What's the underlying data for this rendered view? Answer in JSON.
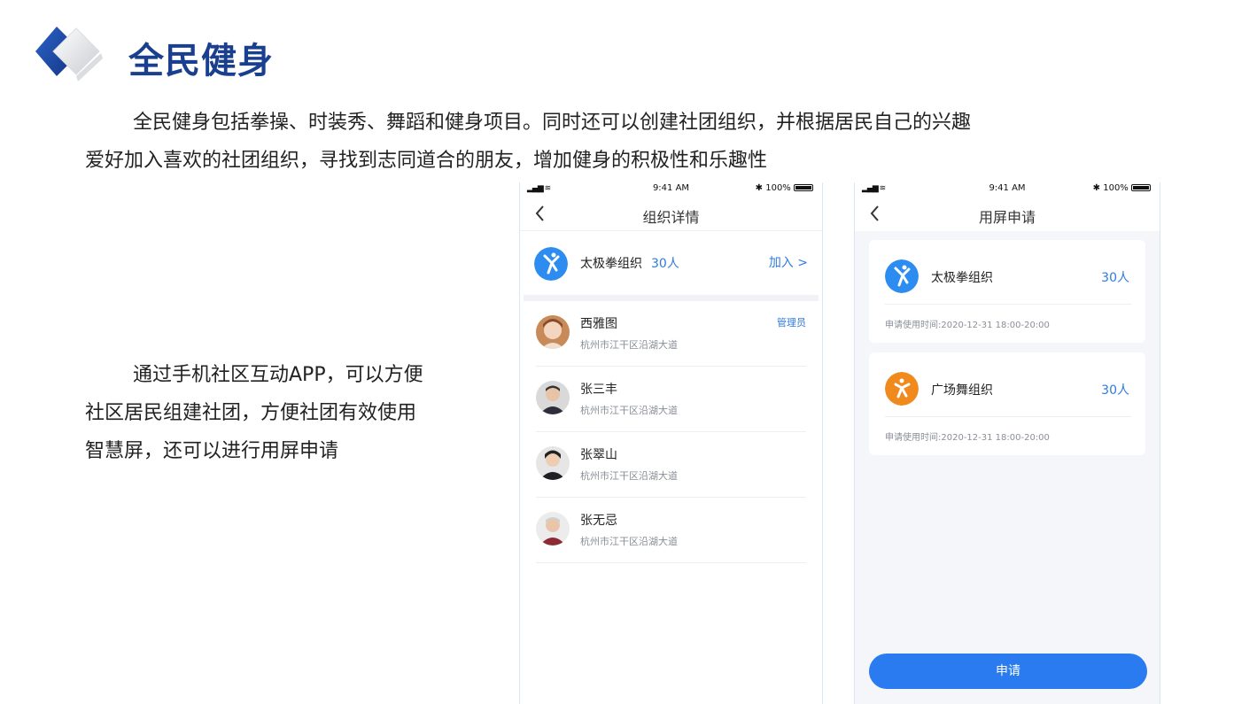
{
  "header": {
    "title": "全民健身"
  },
  "intro": {
    "line1": "全民健身包括拳操、时装秀、舞蹈和健身项目。同时还可以创建社团组织，并根据居民自己的兴趣",
    "line2": "爱好加入喜欢的社团组织，寻找到志同道合的朋友，增加健身的积极性和乐趣性"
  },
  "side_text": {
    "line1": "通过手机社区互动APP，可以方便",
    "line2": "社区居民组建社团，方便社团有效使用",
    "line3": "智慧屏，还可以进行用屏申请"
  },
  "status_bar": {
    "time": "9:41 AM",
    "battery": "100%"
  },
  "phone1": {
    "title": "组织详情",
    "org": {
      "name": "太极拳组织",
      "count": "30人",
      "join_label": "加入 >"
    },
    "members": [
      {
        "name": "西雅图",
        "address": "杭州市江干区沿湖大道",
        "role": "管理员"
      },
      {
        "name": "张三丰",
        "address": "杭州市江干区沿湖大道",
        "role": ""
      },
      {
        "name": "张翠山",
        "address": "杭州市江干区沿湖大道",
        "role": ""
      },
      {
        "name": "张无忌",
        "address": "杭州市江干区沿湖大道",
        "role": ""
      }
    ]
  },
  "phone2": {
    "title": "用屏申请",
    "cards": [
      {
        "name": "太极拳组织",
        "count": "30人",
        "time": "申请使用时间:2020-12-31  18:00-20:00"
      },
      {
        "name": "广场舞组织",
        "count": "30人",
        "time": "申请使用时间:2020-12-31  18:00-20:00"
      }
    ],
    "apply_label": "申请"
  },
  "colors": {
    "brand": "#1b3f8f",
    "accent": "#2f7be0",
    "button": "#2a7af0"
  }
}
